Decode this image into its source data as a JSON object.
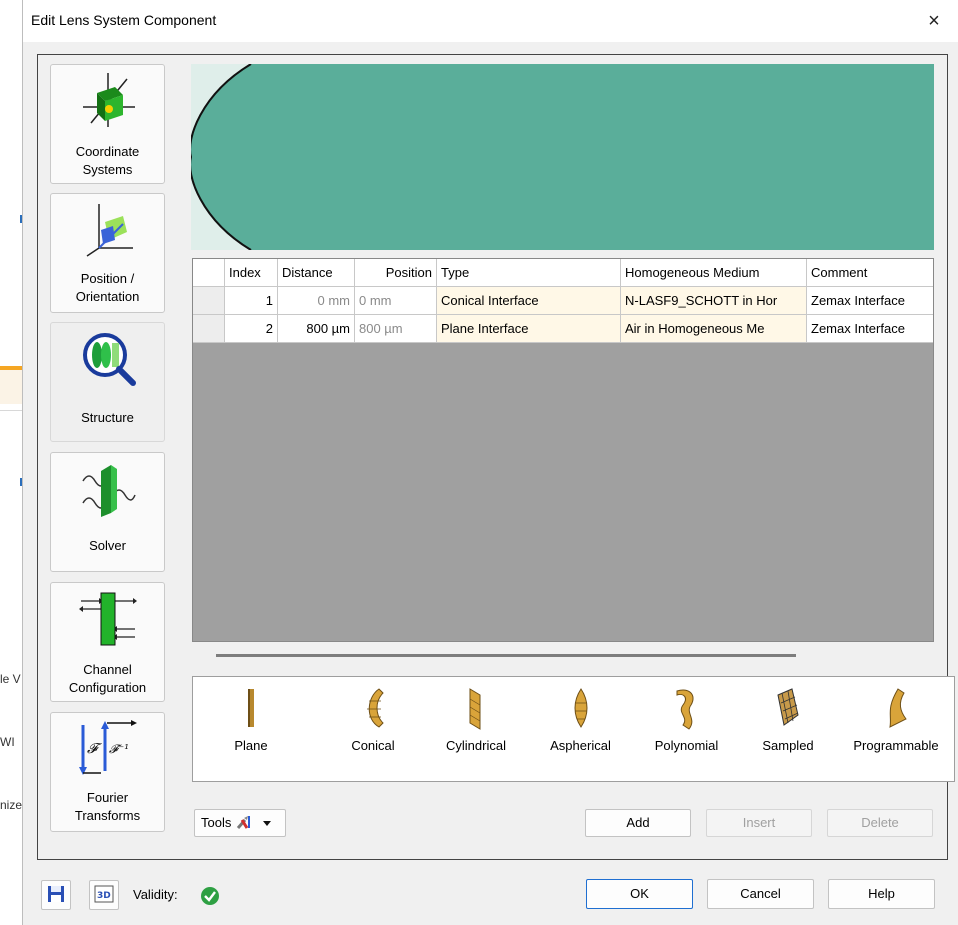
{
  "background": {
    "text_lines": [
      "le V",
      "WI",
      "nize"
    ]
  },
  "dialog": {
    "title": "Edit Lens System Component",
    "close_glyph": "×"
  },
  "nav": [
    {
      "label_lines": [
        "Coordinate",
        "Systems"
      ],
      "icon": "coordinate-systems-icon"
    },
    {
      "label_lines": [
        "Position /",
        "Orientation"
      ],
      "icon": "position-orientation-icon"
    },
    {
      "label_lines": [
        "Structure"
      ],
      "icon": "structure-icon"
    },
    {
      "label_lines": [
        "Solver"
      ],
      "icon": "solver-icon"
    },
    {
      "label_lines": [
        "Channel",
        "Configuration"
      ],
      "icon": "channel-configuration-icon"
    },
    {
      "label_lines": [
        "Fourier",
        "Transforms"
      ],
      "icon": "fourier-transforms-icon",
      "math": [
        "𝓕",
        "𝓕⁻¹"
      ]
    }
  ],
  "table": {
    "columns": [
      "Index",
      "Distance",
      "Position",
      "Type",
      "Homogeneous Medium",
      "Comment"
    ],
    "rows": [
      {
        "index": "1",
        "distance": "0 mm",
        "position": "0 mm",
        "type": "Conical Interface",
        "medium": "N-LASF9_SCHOTT in Hor",
        "comment": "Zemax Interface"
      },
      {
        "index": "2",
        "distance": "800 µm",
        "position": "800 µm",
        "type": "Plane Interface",
        "medium": "Air in Homogeneous Me",
        "comment": "Zemax Interface"
      }
    ]
  },
  "surfaces": [
    {
      "label": "Plane",
      "icon": "plane-surface-icon"
    },
    {
      "label": "Conical",
      "icon": "conical-surface-icon"
    },
    {
      "label": "Cylindrical",
      "icon": "cylindrical-surface-icon"
    },
    {
      "label": "Aspherical",
      "icon": "aspherical-surface-icon"
    },
    {
      "label": "Polynomial",
      "icon": "polynomial-surface-icon"
    },
    {
      "label": "Sampled",
      "icon": "sampled-surface-icon"
    },
    {
      "label": "Programmable",
      "icon": "programmable-surface-icon"
    }
  ],
  "actions": {
    "tools": "Tools",
    "add": "Add",
    "insert": "Insert",
    "delete": "Delete"
  },
  "footer": {
    "validity_label": "Validity:",
    "ok": "OK",
    "cancel": "Cancel",
    "help": "Help"
  },
  "colors": {
    "lens_fill": "#5aae9a",
    "preview_bg": "#dfeeea",
    "grid_bg": "#a0a0a0",
    "valid_green": "#2ea043",
    "accent_blue": "#1f6fd1"
  }
}
